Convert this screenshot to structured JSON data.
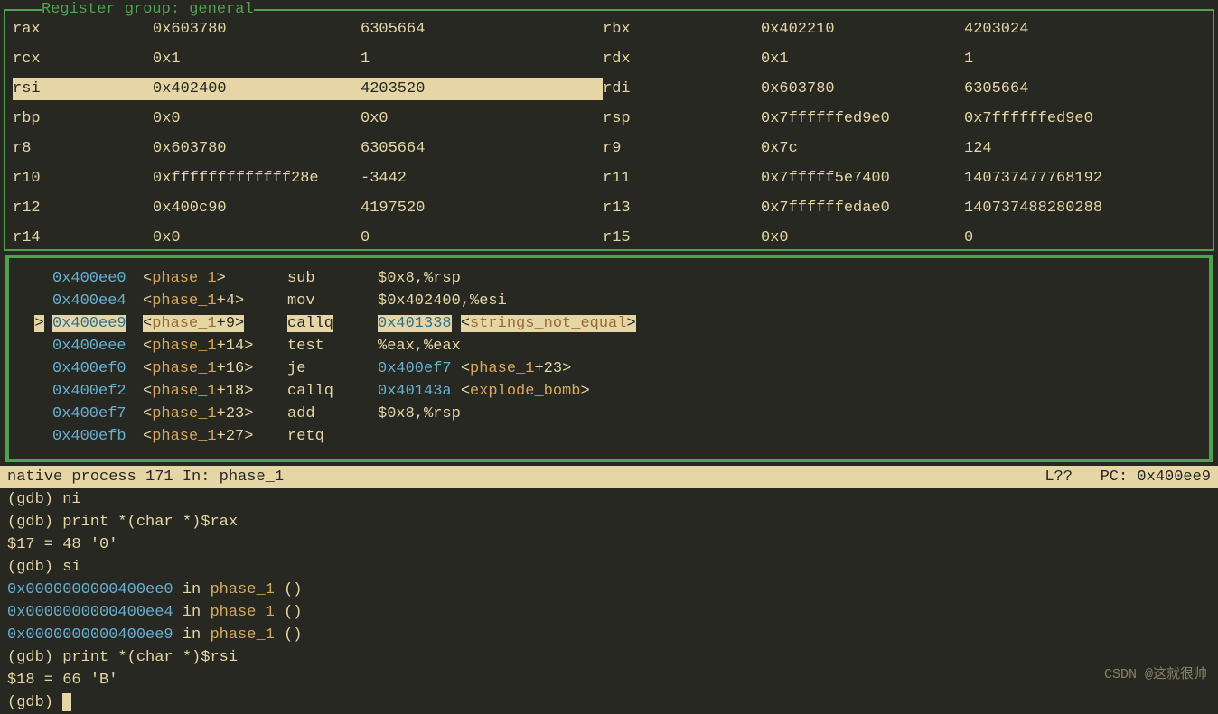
{
  "register_panel": {
    "title": "Register group: general",
    "rows": [
      {
        "l_name": "rax",
        "l_hex": "0x603780",
        "l_dec": "6305664",
        "r_name": "rbx",
        "r_hex": "0x402210",
        "r_dec": "4203024",
        "hl": false
      },
      {
        "l_name": "rcx",
        "l_hex": "0x1",
        "l_dec": "1",
        "r_name": "rdx",
        "r_hex": "0x1",
        "r_dec": "1",
        "hl": false
      },
      {
        "l_name": "rsi",
        "l_hex": "0x402400",
        "l_dec": "4203520",
        "r_name": "rdi",
        "r_hex": "0x603780",
        "r_dec": "6305664",
        "hl": "left"
      },
      {
        "l_name": "rbp",
        "l_hex": "0x0",
        "l_dec": "0x0",
        "r_name": "rsp",
        "r_hex": "0x7ffffffed9e0",
        "r_dec": "0x7ffffffed9e0",
        "hl": false
      },
      {
        "l_name": "r8",
        "l_hex": "0x603780",
        "l_dec": "6305664",
        "r_name": "r9",
        "r_hex": "0x7c",
        "r_dec": "124",
        "hl": false
      },
      {
        "l_name": "r10",
        "l_hex": "0xfffffffffffff28e",
        "l_dec": "-3442",
        "r_name": "r11",
        "r_hex": "0x7fffff5e7400",
        "r_dec": "140737477768192",
        "hl": false
      },
      {
        "l_name": "r12",
        "l_hex": "0x400c90",
        "l_dec": "4197520",
        "r_name": "r13",
        "r_hex": "0x7ffffffedae0",
        "r_dec": "140737488280288",
        "hl": false
      },
      {
        "l_name": "r14",
        "l_hex": "0x0",
        "l_dec": "0",
        "r_name": "r15",
        "r_hex": "0x0",
        "r_dec": "0",
        "hl": false
      }
    ]
  },
  "asm": {
    "lines": [
      {
        "ptr": "",
        "addr": "0x400ee0",
        "sym": "phase_1",
        "off": "",
        "op": "sub",
        "arg": "$0x8,%rsp",
        "target": "",
        "tsym": "",
        "hl": false
      },
      {
        "ptr": "",
        "addr": "0x400ee4",
        "sym": "phase_1",
        "off": "+4",
        "op": "mov",
        "arg": "$0x402400,%esi",
        "target": "",
        "tsym": "",
        "hl": false
      },
      {
        "ptr": ">",
        "addr": "0x400ee9",
        "sym": "phase_1",
        "off": "+9",
        "op": "callq",
        "arg": "",
        "target": "0x401338",
        "tsym": "strings_not_equal",
        "toff": "",
        "hl": true
      },
      {
        "ptr": "",
        "addr": "0x400eee",
        "sym": "phase_1",
        "off": "+14",
        "op": "test",
        "arg": "%eax,%eax",
        "target": "",
        "tsym": "",
        "hl": false
      },
      {
        "ptr": "",
        "addr": "0x400ef0",
        "sym": "phase_1",
        "off": "+16",
        "op": "je",
        "arg": "",
        "target": "0x400ef7",
        "tsym": "phase_1",
        "toff": "+23",
        "hl": false
      },
      {
        "ptr": "",
        "addr": "0x400ef2",
        "sym": "phase_1",
        "off": "+18",
        "op": "callq",
        "arg": "",
        "target": "0x40143a",
        "tsym": "explode_bomb",
        "toff": "",
        "hl": false
      },
      {
        "ptr": "",
        "addr": "0x400ef7",
        "sym": "phase_1",
        "off": "+23",
        "op": "add",
        "arg": "$0x8,%rsp",
        "target": "",
        "tsym": "",
        "hl": false
      },
      {
        "ptr": "",
        "addr": "0x400efb",
        "sym": "phase_1",
        "off": "+27",
        "op": "retq",
        "arg": "",
        "target": "",
        "tsym": "",
        "hl": false
      }
    ]
  },
  "status": {
    "left": "native process 171 In: phase_1",
    "right_l": "L??",
    "right_pc": "PC: 0x400ee9"
  },
  "console": [
    {
      "type": "cmd",
      "prompt": "(gdb) ",
      "text": "ni"
    },
    {
      "type": "cmd",
      "prompt": "(gdb) ",
      "text": "print *(char *)$rax"
    },
    {
      "type": "out",
      "text": "$17 = 48 '0'"
    },
    {
      "type": "cmd",
      "prompt": "(gdb) ",
      "text": "si"
    },
    {
      "type": "step",
      "addr": "0x0000000000400ee0",
      "in": " in ",
      "fn": "phase_1",
      "tail": " ()"
    },
    {
      "type": "step",
      "addr": "0x0000000000400ee4",
      "in": " in ",
      "fn": "phase_1",
      "tail": " ()"
    },
    {
      "type": "step",
      "addr": "0x0000000000400ee9",
      "in": " in ",
      "fn": "phase_1",
      "tail": " ()"
    },
    {
      "type": "cmd",
      "prompt": "(gdb) ",
      "text": "print *(char *)$rsi"
    },
    {
      "type": "out",
      "text": "$18 = 66 'B'"
    },
    {
      "type": "prompt",
      "prompt": "(gdb) "
    }
  ],
  "watermark": "CSDN @这就很帅"
}
